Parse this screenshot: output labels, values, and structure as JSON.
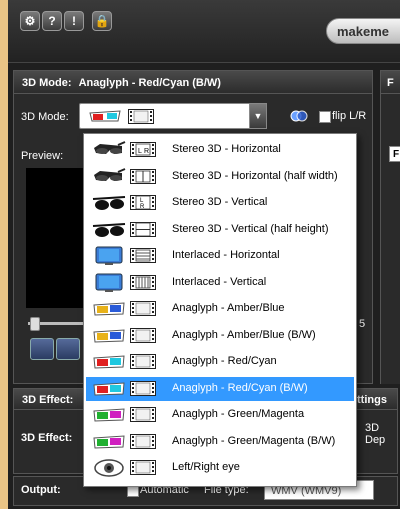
{
  "toolbar": {
    "settings_icon": "gear-icon",
    "help_label": "?",
    "info_label": "!",
    "lock_icon": "lock-icon"
  },
  "logo": {
    "text": "makeme"
  },
  "panel": {
    "title_prefix": "3D Mode:",
    "title_value": "Anaglyph - Red/Cyan (B/W)",
    "mode_label": "3D Mode:",
    "preview_label": "Preview:",
    "flip_label": "flip L/R",
    "right_letter": "F",
    "right_letter2": "F",
    "slider_end": "5"
  },
  "effect": {
    "header": "3D Effect:",
    "header_right": "ttings",
    "label": "3D Effect:",
    "right_label": "3D Dep"
  },
  "output": {
    "label": "Output:",
    "automatic_label": "Automatic",
    "filetype_label": "File type:",
    "filetype_value": "WMV (WMV9)"
  },
  "dropdown": {
    "selected_index": 9,
    "items": [
      {
        "label": "Stereo 3D - Horizontal",
        "icon": "shutter-glasses-icon"
      },
      {
        "label": "Stereo 3D - Horizontal (half width)",
        "icon": "shutter-glasses-icon"
      },
      {
        "label": "Stereo 3D - Vertical",
        "icon": "polarized-glasses-icon"
      },
      {
        "label": "Stereo 3D - Vertical (half height)",
        "icon": "polarized-glasses-icon"
      },
      {
        "label": "Interlaced - Horizontal",
        "icon": "monitor-icon"
      },
      {
        "label": "Interlaced - Vertical",
        "icon": "monitor-icon"
      },
      {
        "label": "Anaglyph - Amber/Blue",
        "icon": "amber-blue-glasses-icon"
      },
      {
        "label": "Anaglyph - Amber/Blue (B/W)",
        "icon": "amber-blue-glasses-icon"
      },
      {
        "label": "Anaglyph - Red/Cyan",
        "icon": "red-cyan-glasses-icon"
      },
      {
        "label": "Anaglyph - Red/Cyan (B/W)",
        "icon": "red-cyan-glasses-icon"
      },
      {
        "label": "Anaglyph - Green/Magenta",
        "icon": "green-magenta-glasses-icon"
      },
      {
        "label": "Anaglyph - Green/Magenta (B/W)",
        "icon": "green-magenta-glasses-icon"
      },
      {
        "label": "Left/Right eye",
        "icon": "eye-icon"
      }
    ]
  },
  "colors": {
    "selection": "#3399ff",
    "amber": "#e8b21a",
    "blue": "#2a5bd8",
    "red": "#e02020",
    "cyan": "#20c8e0",
    "green": "#20b030",
    "magenta": "#d020c0"
  }
}
